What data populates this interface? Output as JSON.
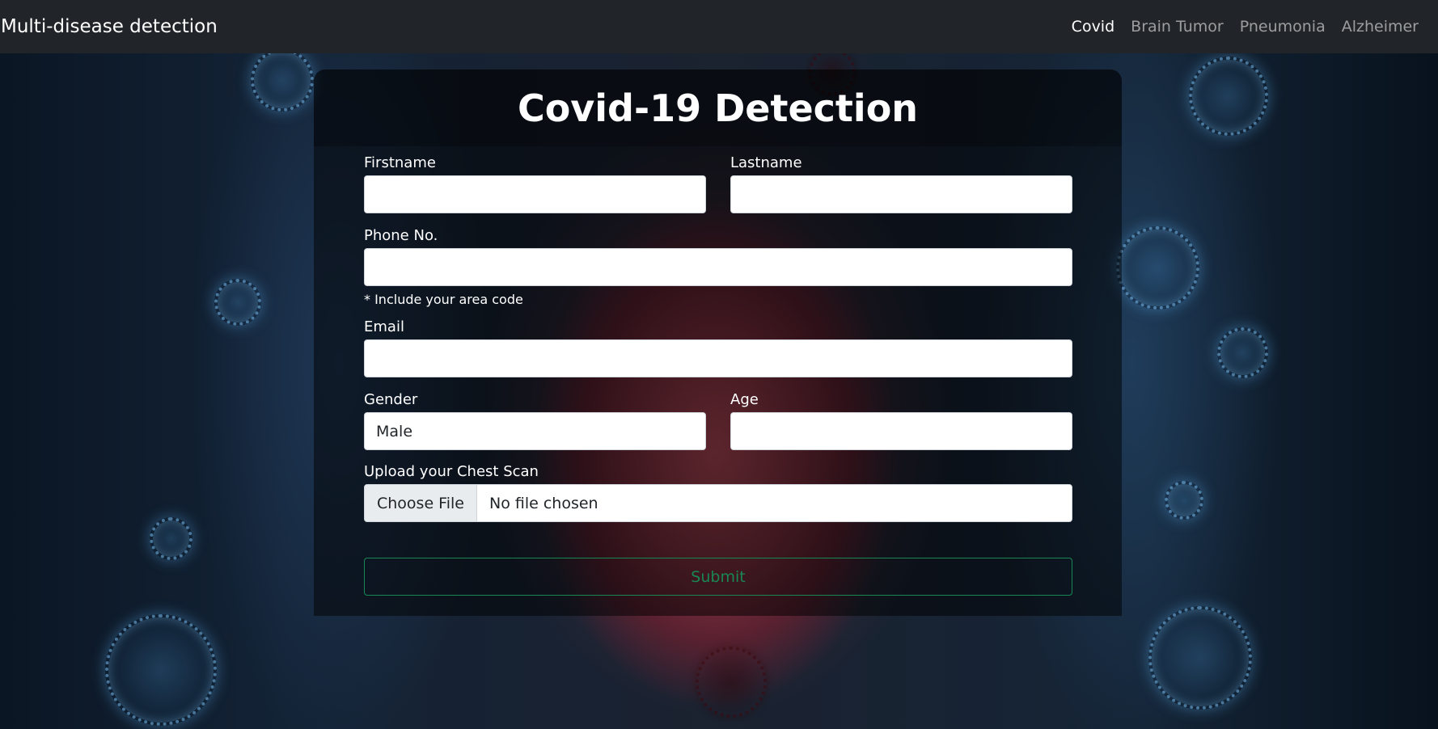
{
  "navbar": {
    "brand": "Multi-disease detection",
    "links": [
      {
        "label": "Covid",
        "active": true
      },
      {
        "label": "Brain Tumor",
        "active": false
      },
      {
        "label": "Pneumonia",
        "active": false
      },
      {
        "label": "Alzheimer",
        "active": false
      }
    ]
  },
  "form": {
    "title": "Covid-19 Detection",
    "firstname_label": "Firstname",
    "firstname_value": "",
    "lastname_label": "Lastname",
    "lastname_value": "",
    "phone_label": "Phone No.",
    "phone_value": "",
    "phone_help": "* Include your area code",
    "email_label": "Email",
    "email_value": "",
    "gender_label": "Gender",
    "gender_value": "Male",
    "age_label": "Age",
    "age_value": "",
    "upload_label": "Upload your Chest Scan",
    "file_button": "Choose File",
    "file_status": "No file chosen",
    "submit_label": "Submit"
  },
  "colors": {
    "navbar_bg": "#212529",
    "submit_outline": "#198754"
  }
}
